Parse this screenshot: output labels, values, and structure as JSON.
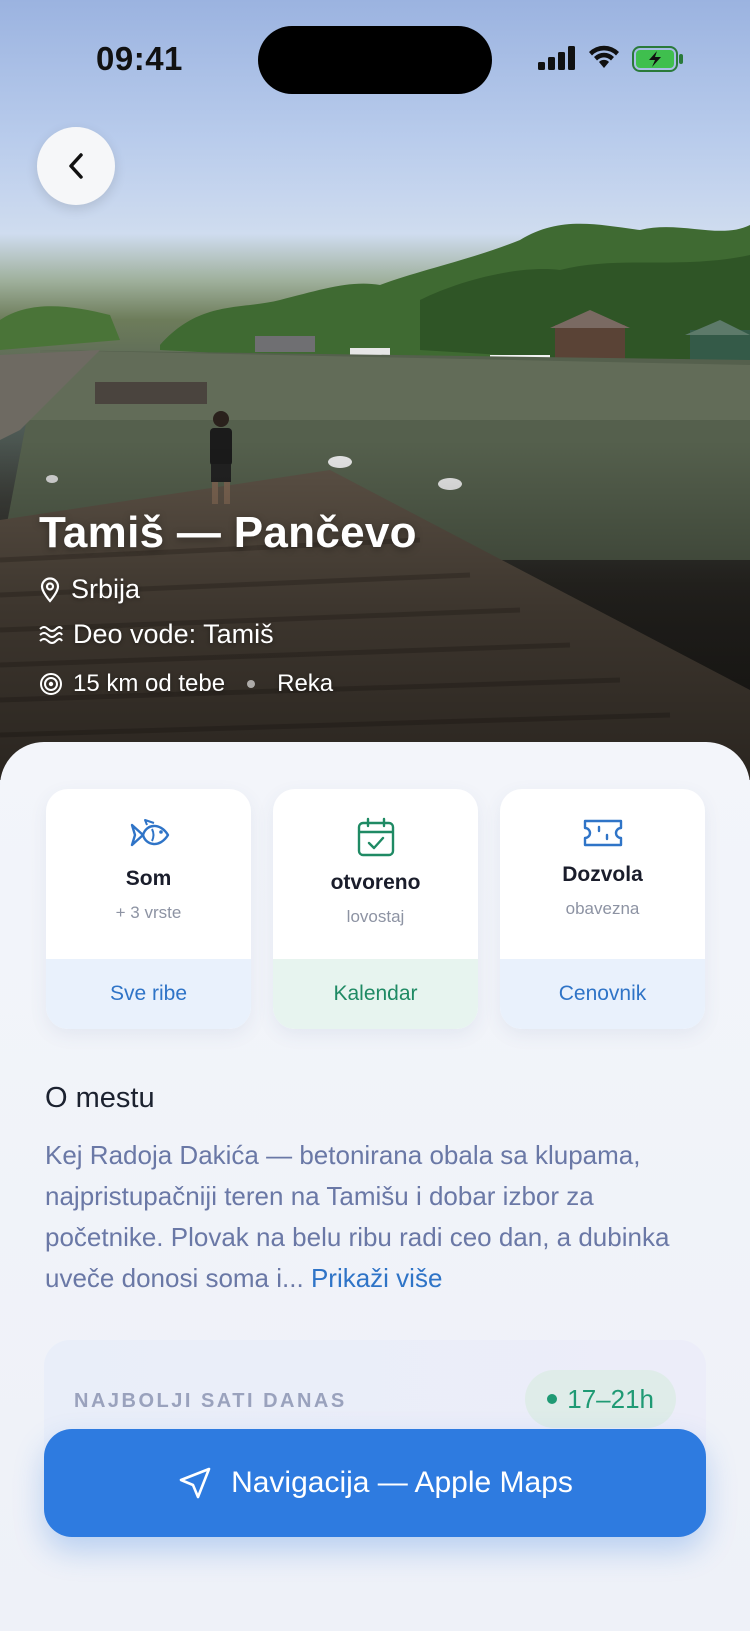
{
  "status_bar": {
    "time": "09:41"
  },
  "hero": {
    "title": "Tamiš — Pančevo",
    "location": "Srbija",
    "water_part": "Deo vode: Tamiš",
    "distance": "15 km od tebe",
    "water_type": "Reka"
  },
  "cards": [
    {
      "main": "Som",
      "sub": "+ 3 vrste",
      "action": "Sve ribe",
      "icon": "fish-icon"
    },
    {
      "main": "otvoreno",
      "sub": "lovostaj",
      "action": "Kalendar",
      "icon": "calendar-check-icon"
    },
    {
      "main": "Dozvola",
      "sub": "obavezna",
      "action": "Cenovnik",
      "icon": "ticket-icon"
    }
  ],
  "about": {
    "heading": "O mestu",
    "text": "Kej Radoja Dakića — betonirana obala sa klupama, najpristupačniji teren na Tamišu i dobar izbor za početnike. Plovak na belu ribu radi ceo dan, a dubinka uveče donosi soma i...",
    "more_link": "Prikaži više"
  },
  "best_hours": {
    "label": "NAJBOLJI SATI DANAS",
    "value": "17–21h"
  },
  "navigation_button": {
    "label": "Navigacija — Apple Maps"
  },
  "colors": {
    "accent": "#2e7be0",
    "link": "#2f74c7",
    "green": "#1f8a64"
  }
}
